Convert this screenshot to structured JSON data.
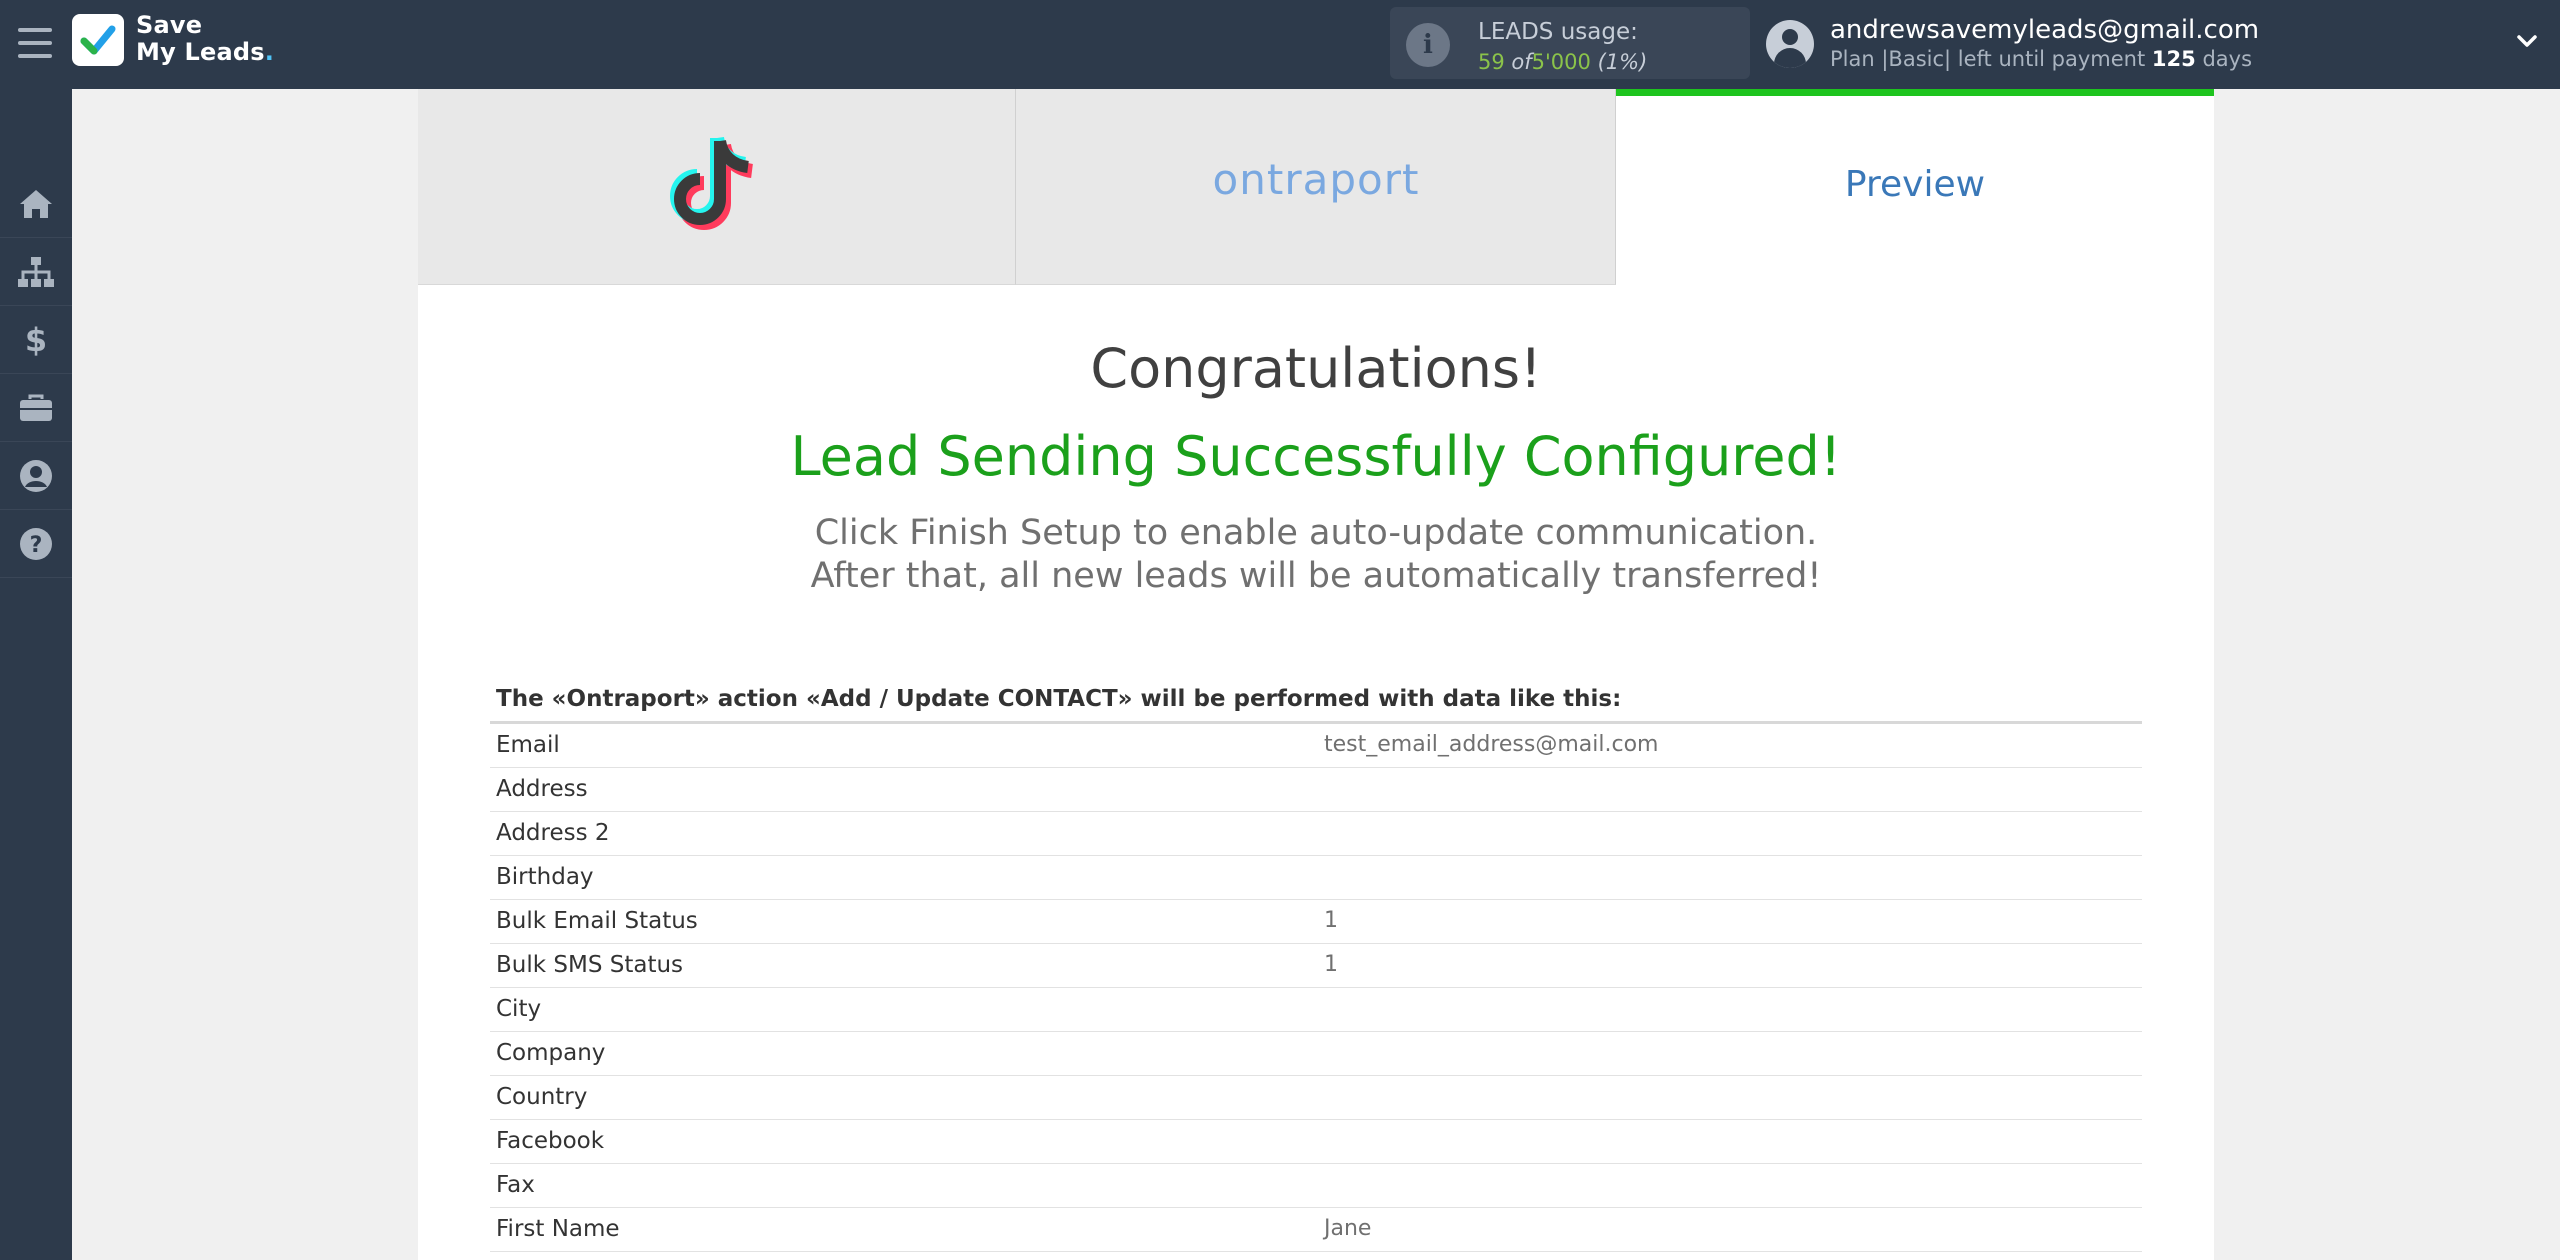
{
  "header": {
    "logo_line1": "Save",
    "logo_line2": "My Leads",
    "logo_dot": ".",
    "usage_label": "LEADS usage:",
    "usage_used": "59",
    "usage_of": "of",
    "usage_total": "5'000",
    "usage_pct": "(1%)",
    "user_email": "andrewsavemyleads@gmail.com",
    "plan_prefix": "Plan |Basic| left until payment",
    "plan_days": "125",
    "plan_suffix": "days"
  },
  "sidebar": {
    "items": [
      {
        "name": "home-icon"
      },
      {
        "name": "sitemap-icon"
      },
      {
        "name": "dollar-icon"
      },
      {
        "name": "briefcase-icon"
      },
      {
        "name": "account-icon"
      },
      {
        "name": "help-icon"
      }
    ]
  },
  "tabs": {
    "tab2_label": "ontraport",
    "tab3_label": "Preview"
  },
  "main": {
    "congrats": "Congratulations!",
    "success": "Lead Sending Successfully Configured!",
    "hint1": "Click Finish Setup to enable auto-update communication.",
    "hint2": "After that, all new leads will be automatically transferred!",
    "action_line": "The «Ontraport» action «Add / Update CONTACT» will be performed with data like this:",
    "rows": [
      {
        "field": "Email",
        "value": "test_email_address@mail.com"
      },
      {
        "field": "Address",
        "value": ""
      },
      {
        "field": "Address 2",
        "value": ""
      },
      {
        "field": "Birthday",
        "value": ""
      },
      {
        "field": "Bulk Email Status",
        "value": "1"
      },
      {
        "field": "Bulk SMS Status",
        "value": "1"
      },
      {
        "field": "City",
        "value": ""
      },
      {
        "field": "Company",
        "value": ""
      },
      {
        "field": "Country",
        "value": ""
      },
      {
        "field": "Facebook",
        "value": ""
      },
      {
        "field": "Fax",
        "value": ""
      },
      {
        "field": "First Name",
        "value": "Jane"
      }
    ]
  },
  "colors": {
    "topbar": "#2d3a4b",
    "accent_green": "#1ba01b",
    "tab_active_border": "#1ec41e",
    "preview_blue": "#3a78b8"
  }
}
